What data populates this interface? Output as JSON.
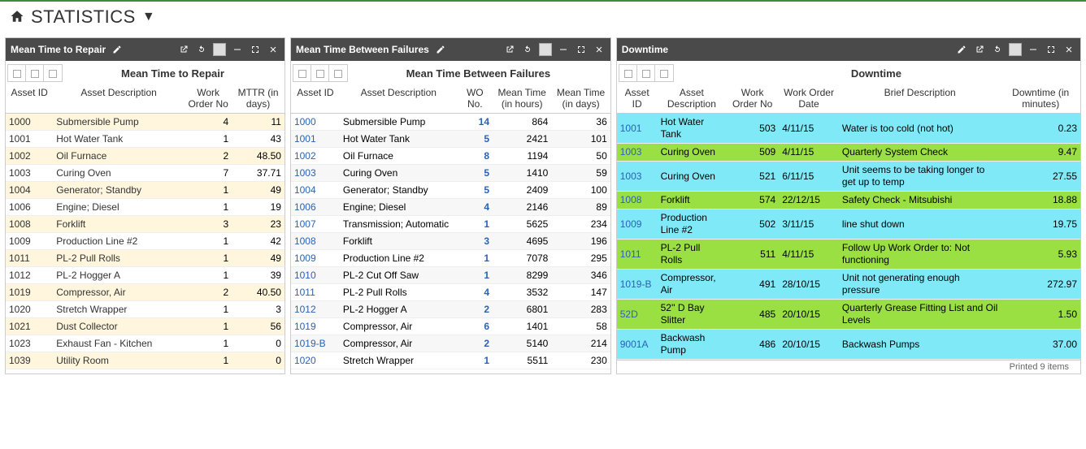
{
  "header": {
    "title": "STATISTICS"
  },
  "panels": {
    "mttr": {
      "header_title": "Mean Time to Repair",
      "subtitle": "Mean Time to Repair",
      "columns": [
        "Asset ID",
        "Asset Description",
        "Work Order No",
        "MTTR (in days)"
      ],
      "rows": [
        {
          "id": "1000",
          "desc": "Submersible Pump",
          "wo": "4",
          "val": "11"
        },
        {
          "id": "1001",
          "desc": "Hot Water Tank",
          "wo": "1",
          "val": "43"
        },
        {
          "id": "1002",
          "desc": "Oil Furnace",
          "wo": "2",
          "val": "48.50"
        },
        {
          "id": "1003",
          "desc": "Curing Oven",
          "wo": "7",
          "val": "37.71"
        },
        {
          "id": "1004",
          "desc": "Generator; Standby",
          "wo": "1",
          "val": "49"
        },
        {
          "id": "1006",
          "desc": "Engine; Diesel",
          "wo": "1",
          "val": "19"
        },
        {
          "id": "1008",
          "desc": "Forklift",
          "wo": "3",
          "val": "23"
        },
        {
          "id": "1009",
          "desc": "Production Line #2",
          "wo": "1",
          "val": "42"
        },
        {
          "id": "1011",
          "desc": "PL-2 Pull Rolls",
          "wo": "1",
          "val": "49"
        },
        {
          "id": "1012",
          "desc": "PL-2 Hogger A",
          "wo": "1",
          "val": "39"
        },
        {
          "id": "1019",
          "desc": "Compressor, Air",
          "wo": "2",
          "val": "40.50"
        },
        {
          "id": "1020",
          "desc": "Stretch Wrapper",
          "wo": "1",
          "val": "3"
        },
        {
          "id": "1021",
          "desc": "Dust Collector",
          "wo": "1",
          "val": "56"
        },
        {
          "id": "1023",
          "desc": "Exhaust Fan - Kitchen",
          "wo": "1",
          "val": "0"
        },
        {
          "id": "1039",
          "desc": "Utility Room",
          "wo": "1",
          "val": "0"
        }
      ]
    },
    "mtbf": {
      "header_title": "Mean Time Between Failures",
      "subtitle": "Mean Time Between Failures",
      "columns": [
        "Asset ID",
        "Asset Description",
        "WO No.",
        "Mean Time (in hours)",
        "Mean Time (in days)"
      ],
      "rows": [
        {
          "id": "1000",
          "desc": "Submersible Pump",
          "wo": "14",
          "h": "864",
          "d": "36"
        },
        {
          "id": "1001",
          "desc": "Hot Water Tank",
          "wo": "5",
          "h": "2421",
          "d": "101"
        },
        {
          "id": "1002",
          "desc": "Oil Furnace",
          "wo": "8",
          "h": "1194",
          "d": "50"
        },
        {
          "id": "1003",
          "desc": "Curing Oven",
          "wo": "5",
          "h": "1410",
          "d": "59"
        },
        {
          "id": "1004",
          "desc": "Generator; Standby",
          "wo": "5",
          "h": "2409",
          "d": "100"
        },
        {
          "id": "1006",
          "desc": "Engine; Diesel",
          "wo": "4",
          "h": "2146",
          "d": "89"
        },
        {
          "id": "1007",
          "desc": "Transmission; Automatic",
          "wo": "1",
          "h": "5625",
          "d": "234"
        },
        {
          "id": "1008",
          "desc": "Forklift",
          "wo": "3",
          "h": "4695",
          "d": "196"
        },
        {
          "id": "1009",
          "desc": "Production Line #2",
          "wo": "1",
          "h": "7078",
          "d": "295"
        },
        {
          "id": "1010",
          "desc": "PL-2 Cut Off Saw",
          "wo": "1",
          "h": "8299",
          "d": "346"
        },
        {
          "id": "1011",
          "desc": "PL-2 Pull Rolls",
          "wo": "4",
          "h": "3532",
          "d": "147"
        },
        {
          "id": "1012",
          "desc": "PL-2 Hogger A",
          "wo": "2",
          "h": "6801",
          "d": "283"
        },
        {
          "id": "1019",
          "desc": "Compressor, Air",
          "wo": "6",
          "h": "1401",
          "d": "58"
        },
        {
          "id": "1019-B",
          "desc": "Compressor, Air",
          "wo": "2",
          "h": "5140",
          "d": "214"
        },
        {
          "id": "1020",
          "desc": "Stretch Wrapper",
          "wo": "1",
          "h": "5511",
          "d": "230"
        }
      ]
    },
    "downtime": {
      "header_title": "Downtime",
      "subtitle": "Downtime",
      "columns": [
        "Asset ID",
        "Asset Description",
        "Work Order No",
        "Work Order Date",
        "Brief Description",
        "Downtime (in minutes)"
      ],
      "rows": [
        {
          "color": "cyan",
          "id": "1001",
          "desc": "Hot Water Tank",
          "wo": "503",
          "date": "4/11/15",
          "brief": "Water is too cold (not hot)",
          "dt": "0.23"
        },
        {
          "color": "green",
          "id": "1003",
          "desc": "Curing Oven",
          "wo": "509",
          "date": "4/11/15",
          "brief": "Quarterly System Check",
          "dt": "9.47"
        },
        {
          "color": "cyan",
          "id": "1003",
          "desc": "Curing Oven",
          "wo": "521",
          "date": "6/11/15",
          "brief": "Unit seems to be taking longer to get up to temp",
          "dt": "27.55"
        },
        {
          "color": "green",
          "id": "1008",
          "desc": "Forklift",
          "wo": "574",
          "date": "22/12/15",
          "brief": "Safety Check - Mitsubishi",
          "dt": "18.88"
        },
        {
          "color": "cyan",
          "id": "1009",
          "desc": "Production Line #2",
          "wo": "502",
          "date": "3/11/15",
          "brief": "line shut down",
          "dt": "19.75"
        },
        {
          "color": "green",
          "id": "1011",
          "desc": "PL-2 Pull Rolls",
          "wo": "511",
          "date": "4/11/15",
          "brief": "Follow Up Work Order to: Not functioning",
          "dt": "5.93"
        },
        {
          "color": "cyan",
          "id": "1019-B",
          "desc": "Compressor, Air",
          "wo": "491",
          "date": "28/10/15",
          "brief": "Unit not generating enough pressure",
          "dt": "272.97"
        },
        {
          "color": "green",
          "id": "52D",
          "desc": "52'' D Bay Slitter",
          "wo": "485",
          "date": "20/10/15",
          "brief": "Quarterly Grease Fitting List and Oil Levels",
          "dt": "1.50"
        },
        {
          "color": "cyan",
          "id": "9001A",
          "desc": "Backwash Pump",
          "wo": "486",
          "date": "20/10/15",
          "brief": "Backwash Pumps",
          "dt": "37.00"
        }
      ],
      "footer": "Printed 9 items"
    }
  }
}
